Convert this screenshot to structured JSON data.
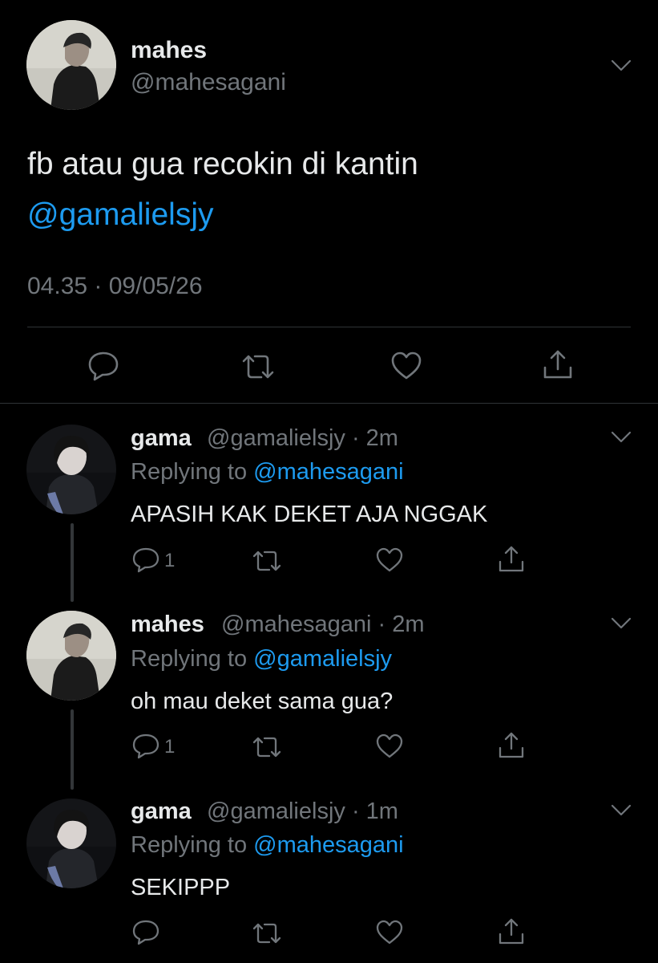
{
  "main_tweet": {
    "display_name": "mahes",
    "handle": "@mahesagani",
    "text": "fb atau gua recokin di kantin",
    "mention": "@gamalielsjy",
    "timestamp": "04.35 · 09/05/26",
    "actions": [
      "reply-icon",
      "retweet-icon",
      "like-icon",
      "share-icon"
    ]
  },
  "replies": [
    {
      "display_name": "gama",
      "handle_time": "@gamalielsjy · 2m",
      "replying_prefix": "Replying to",
      "replying_to": "@mahesagani",
      "text": "APASIH KAK DEKET AJA NGGAK",
      "reply_count": "1"
    },
    {
      "display_name": "mahes",
      "handle_time": "@mahesagani · 2m",
      "replying_prefix": "Replying to",
      "replying_to": "@gamalielsjy",
      "text": "oh mau deket sama gua?",
      "reply_count": "1"
    },
    {
      "display_name": "gama",
      "handle_time": "@gamalielsjy · 1m",
      "replying_prefix": "Replying to",
      "replying_to": "@mahesagani",
      "text": "SEKIPPP",
      "reply_count": ""
    }
  ],
  "colors": {
    "background": "#000000",
    "text": "#e7e9ea",
    "secondary": "#71767b",
    "link": "#1d9bf0",
    "divider": "#2f3336"
  }
}
